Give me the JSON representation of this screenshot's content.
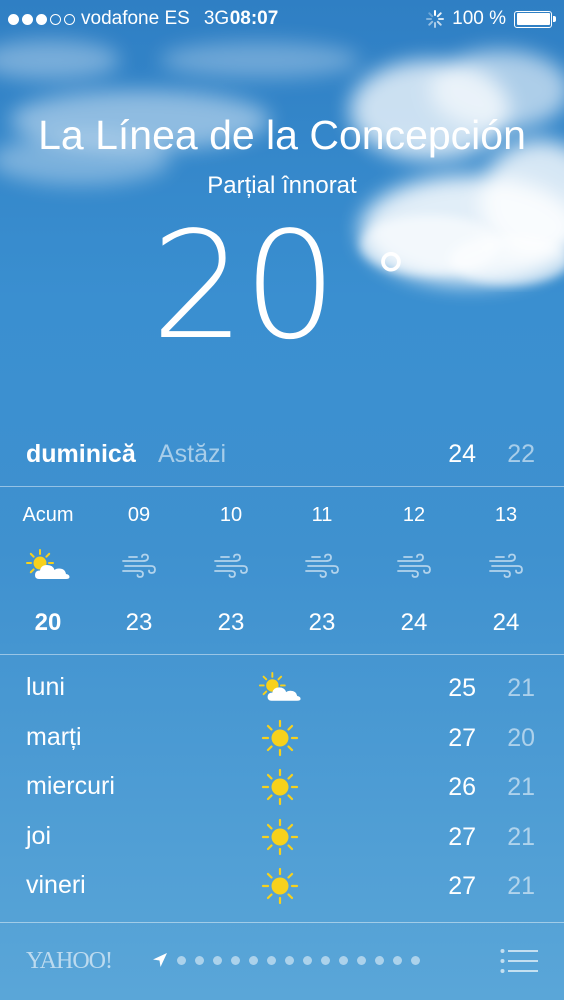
{
  "status_bar": {
    "carrier": "vodafone ES",
    "network": "3G",
    "time": "08:07",
    "battery": "100 %",
    "signal_bars_filled": 3,
    "signal_bars_total": 5
  },
  "location": {
    "city": "La Línea de la Concepción",
    "condition": "Parțial înnorat",
    "temperature": "20",
    "degree_symbol": "°"
  },
  "today": {
    "day": "duminică",
    "label": "Astăzi",
    "high": "24",
    "low": "22"
  },
  "hourly": [
    {
      "label": "Acum",
      "icon": "partly-cloudy-icon",
      "temp": "20"
    },
    {
      "label": "09",
      "icon": "wind-icon",
      "temp": "23"
    },
    {
      "label": "10",
      "icon": "wind-icon",
      "temp": "23"
    },
    {
      "label": "11",
      "icon": "wind-icon",
      "temp": "23"
    },
    {
      "label": "12",
      "icon": "wind-icon",
      "temp": "24"
    },
    {
      "label": "13",
      "icon": "wind-icon",
      "temp": "24"
    }
  ],
  "daily": [
    {
      "day": "luni",
      "icon": "partly-cloudy-icon",
      "high": "25",
      "low": "21"
    },
    {
      "day": "marți",
      "icon": "sun-icon",
      "high": "27",
      "low": "20"
    },
    {
      "day": "miercuri",
      "icon": "sun-icon",
      "high": "26",
      "low": "21"
    },
    {
      "day": "joi",
      "icon": "sun-icon",
      "high": "27",
      "low": "21"
    },
    {
      "day": "vineri",
      "icon": "sun-icon",
      "high": "27",
      "low": "21"
    }
  ],
  "footer": {
    "brand": "YAHOO!",
    "page_count": 14,
    "current_page": 0
  },
  "colors": {
    "sky_top": "#2f7fc4",
    "sky_bottom": "#5aa6d8",
    "sun": "#f7d11c"
  }
}
